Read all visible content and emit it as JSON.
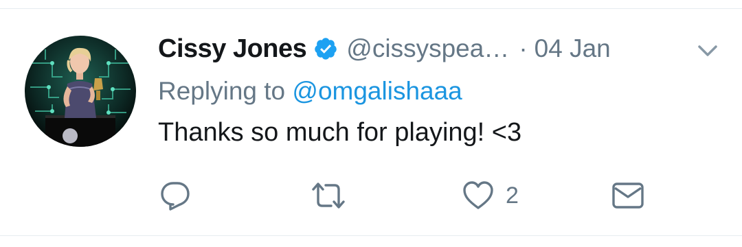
{
  "tweet": {
    "display_name": "Cissy Jones",
    "handle": "@cissyspea…",
    "separator": "·",
    "date": "04 Jan",
    "replying_prefix": "Replying to",
    "replying_to": "@omgalishaaa",
    "text": "Thanks so much for playing! <3"
  },
  "actions": {
    "reply": {
      "icon": "reply-icon",
      "count": ""
    },
    "retweet": {
      "icon": "retweet-icon",
      "count": ""
    },
    "like": {
      "icon": "heart-icon",
      "count": "2"
    },
    "dm": {
      "icon": "envelope-icon",
      "count": ""
    }
  },
  "colors": {
    "primary_text": "#14171a",
    "secondary_text": "#657786",
    "link": "#1b95e0",
    "verified_badge": "#1da1f2"
  }
}
